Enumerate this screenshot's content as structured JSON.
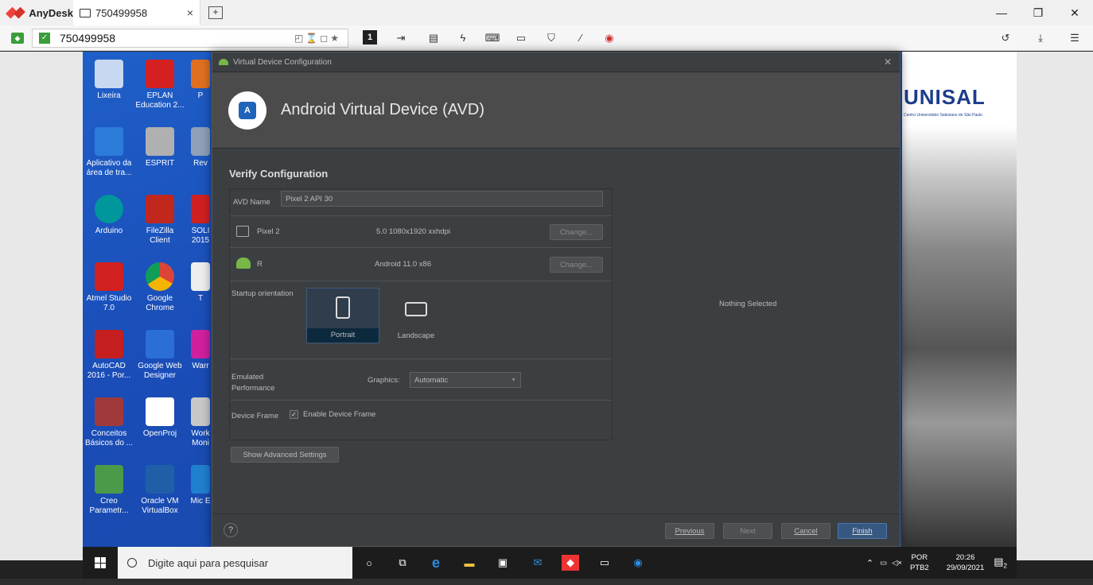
{
  "anydesk": {
    "app_name": "AnyDesk",
    "tab_label": "750499958",
    "tab_close": "×",
    "new_tab": "+",
    "address": "750499958",
    "address_tools": "◰⌛◻★",
    "session_number": "1"
  },
  "window_controls": {
    "minimize": "—",
    "maximize": "❐",
    "close": "✕"
  },
  "desktop_icons": [
    {
      "label": "Lixeira",
      "color": "#c8d8f0"
    },
    {
      "label": "EPLAN Education 2...",
      "color": "#d42020"
    },
    {
      "label": "Aplicativo da área de tra...",
      "color": "#2d7bd8"
    },
    {
      "label": "ESPRIT",
      "color": "#b0b0b0"
    },
    {
      "label": "Arduino",
      "color": "#00979c"
    },
    {
      "label": "FileZilla Client",
      "color": "#c0281e"
    },
    {
      "label": "Atmel Studio 7.0",
      "color": "#d02020"
    },
    {
      "label": "Google Chrome",
      "color": "#e0a020"
    },
    {
      "label": "AutoCAD 2016 - Por...",
      "color": "#c41e1e"
    },
    {
      "label": "Google Web Designer",
      "color": "#2b6fd6"
    },
    {
      "label": "Conceitos Básicos do ...",
      "color": "#a03a3a"
    },
    {
      "label": "OpenProj",
      "color": "#ffffff"
    },
    {
      "label": "Creo Parametr...",
      "color": "#4a9a4a"
    },
    {
      "label": "Oracle VM VirtualBox",
      "color": "#1f5fa8"
    }
  ],
  "partial_icons": [
    "P",
    "Rev",
    "SOLI 2015",
    "T",
    "Warr",
    "Work Moni",
    "Mic E"
  ],
  "wallpaper": {
    "brand": "UNISAL",
    "brand_sub": "Centro Universitário Salesiano de São Paulo"
  },
  "dialog": {
    "window_title": "Virtual Device Configuration",
    "close": "✕",
    "header_title": "Android Virtual Device (AVD)",
    "section_title": "Verify Configuration",
    "avd_name_label": "AVD Name",
    "avd_name_value": "Pixel 2 API 30",
    "device_name": "Pixel 2",
    "device_spec": "5.0 1080x1920 xxhdpi",
    "device_change": "Change...",
    "system_image_name": "R",
    "system_image_spec": "Android 11.0 x86",
    "image_change": "Change...",
    "startup_orientation_label": "Startup orientation",
    "portrait": "Portrait",
    "landscape": "Landscape",
    "emulated_performance_label": "Emulated Performance",
    "graphics_label": "Graphics:",
    "graphics_value": "Automatic",
    "device_frame_label": "Device Frame",
    "enable_device_frame": "Enable Device Frame",
    "nothing_selected": "Nothing Selected",
    "show_advanced": "Show Advanced Settings",
    "help": "?",
    "previous": "Previous",
    "next": "Next",
    "cancel": "Cancel",
    "finish": "Finish"
  },
  "taskbar": {
    "search_placeholder": "Digite aqui para pesquisar",
    "lang_top": "POR",
    "lang_bottom": "PTB2",
    "time": "20:26",
    "date": "29/09/2021",
    "notification_count": "2"
  }
}
